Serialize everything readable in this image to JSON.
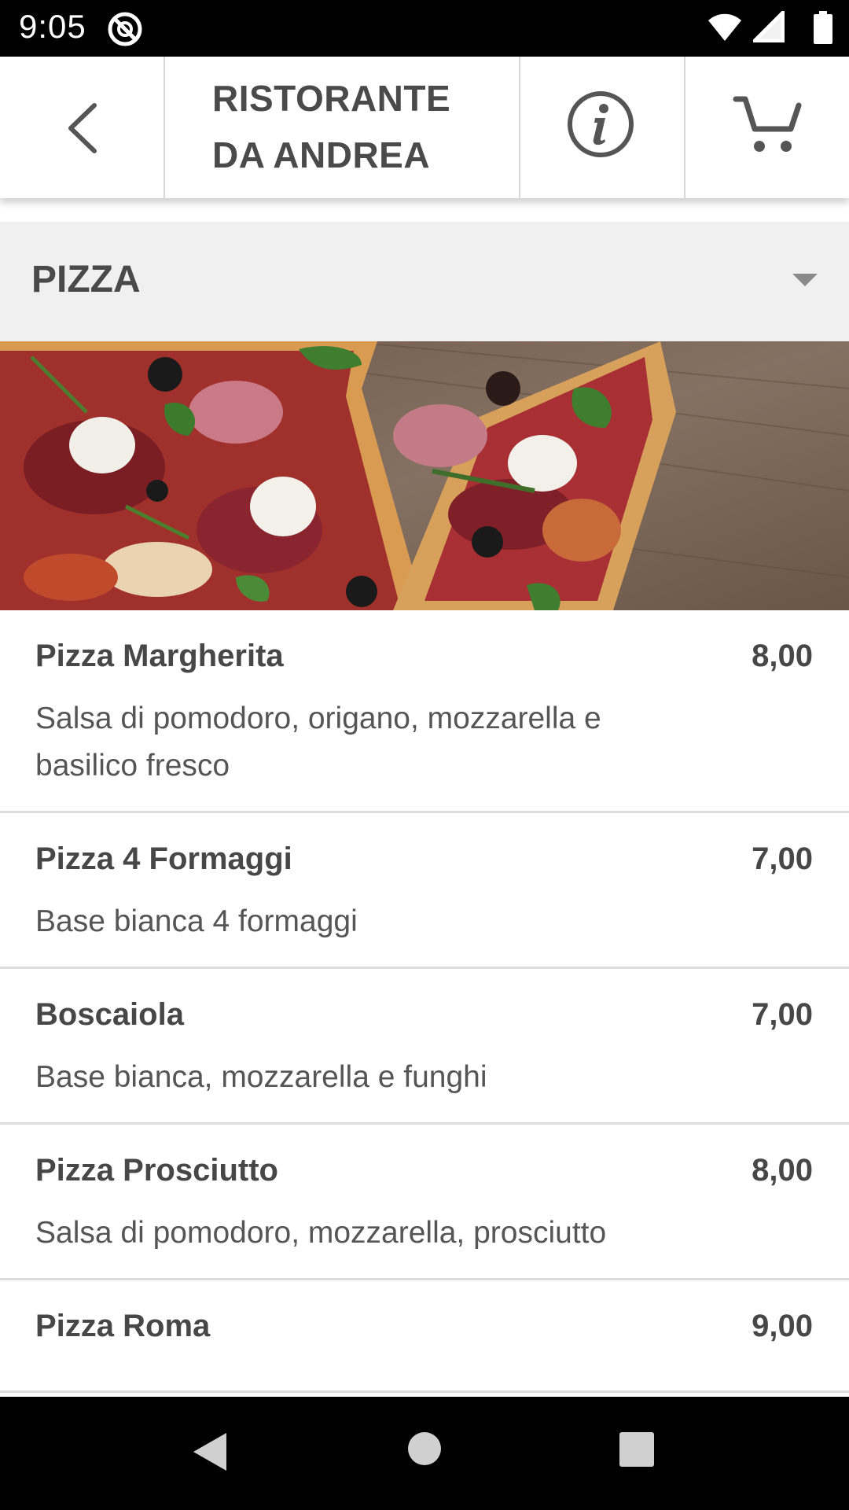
{
  "status_bar": {
    "time": "9:05",
    "icons": [
      "app-notification-icon",
      "wifi-icon",
      "signal-icon",
      "battery-icon"
    ]
  },
  "top_bar": {
    "back_icon": "chevron-left-icon",
    "title_line1": "RISTORANTE",
    "title_line2": "DA ANDREA",
    "info_icon": "info-icon",
    "cart_icon": "cart-icon"
  },
  "category": {
    "title": "PIZZA",
    "toggle_icon": "caret-down-icon"
  },
  "hero": {
    "image": "pizza-photo"
  },
  "menu": {
    "items": [
      {
        "name": "Pizza Margherita",
        "price": "8,00",
        "description": "Salsa di pomodoro, origano, mozzarella e basilico fresco"
      },
      {
        "name": "Pizza 4 Formaggi",
        "price": "7,00",
        "description": "Base bianca 4 formaggi"
      },
      {
        "name": "Boscaiola",
        "price": "7,00",
        "description": "Base bianca, mozzarella e funghi"
      },
      {
        "name": "Pizza Prosciutto",
        "price": "8,00",
        "description": "Salsa di pomodoro, mozzarella, prosciutto"
      },
      {
        "name": "Pizza Roma",
        "price": "9,00",
        "description": ""
      }
    ]
  },
  "nav_bar": {
    "icons": [
      "nav-back-icon",
      "nav-home-icon",
      "nav-recents-icon"
    ]
  },
  "colors": {
    "status_bar_bg": "#000000",
    "header_bg": "#ffffff",
    "category_bg": "#f0f0f0",
    "text_primary": "#474747",
    "divider": "#dcdcdc"
  }
}
